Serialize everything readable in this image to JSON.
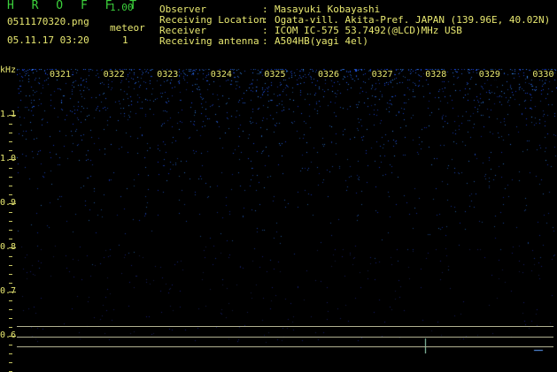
{
  "header": {
    "title": "H R O F F T",
    "version": "1.00",
    "filename": "0511170320.png",
    "meteor_label": "meteor",
    "timestamp": "05.11.17 03:20",
    "meteor_count": "1"
  },
  "info": [
    {
      "key": "Observer",
      "value": "Masayuki Kobayashi"
    },
    {
      "key": "Receiving Location",
      "value": "Ogata-vill. Akita-Pref. JAPAN (139.96E, 40.02N)"
    },
    {
      "key": "Receiver",
      "value": "ICOM IC-575 53.7492(@LCD)MHz USB"
    },
    {
      "key": "Receiving antenna",
      "value": "A504HB(yagi 4el)"
    }
  ],
  "axis": {
    "unit": "kHz",
    "ticks": [
      "1.1",
      "1.0",
      "0.9",
      "0.8",
      "0.7",
      "0.6"
    ],
    "tick_values": [
      1.1,
      1.0,
      0.9,
      0.8,
      0.7,
      0.6
    ]
  },
  "minutes": [
    "0321",
    "0322",
    "0323",
    "0324",
    "0325",
    "0326",
    "0327",
    "0328",
    "0329",
    "0330"
  ],
  "colors": {
    "background": "#000000",
    "text": "#e8e870",
    "title": "#3cd23c",
    "noise": "#3050ff"
  }
}
